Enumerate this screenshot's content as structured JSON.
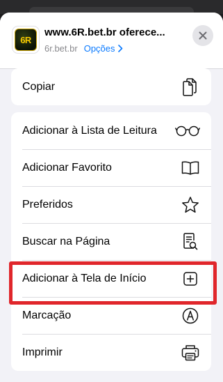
{
  "header": {
    "app_icon_text": "6R",
    "title": "www.6R.bet.br oferece...",
    "domain": "6r.bet.br",
    "options_label": "Opções"
  },
  "actions_top": [
    {
      "label": "Copiar",
      "icon": "copy-icon"
    }
  ],
  "actions": [
    {
      "label": "Adicionar à Lista de Leitura",
      "icon": "glasses-icon"
    },
    {
      "label": "Adicionar Favorito",
      "icon": "book-icon"
    },
    {
      "label": "Preferidos",
      "icon": "star-icon"
    },
    {
      "label": "Buscar na Página",
      "icon": "find-in-page-icon"
    },
    {
      "label": "Adicionar à Tela de Início",
      "icon": "add-square-icon"
    },
    {
      "label": "Marcação",
      "icon": "markup-icon"
    },
    {
      "label": "Imprimir",
      "icon": "print-icon"
    }
  ],
  "colors": {
    "accent": "#0a7aff",
    "highlight": "#e0262b",
    "sheet_background": "#f2f2f7"
  }
}
